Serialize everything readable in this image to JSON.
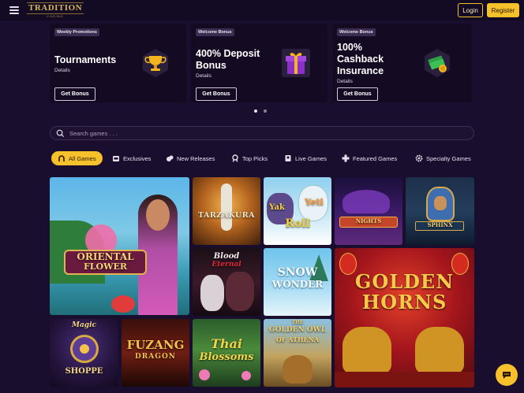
{
  "header": {
    "logo_text": "TRADITION",
    "logo_sub": "CASINO",
    "login_label": "Login",
    "register_label": "Register"
  },
  "promos": [
    {
      "tag": "Weekly Promotions",
      "title": "Tournaments",
      "details": "Details",
      "button": "Get Bonus",
      "icon": "trophy-icon"
    },
    {
      "tag": "Welcome Bonus",
      "title_line1": "400% Deposit",
      "title_line2": "Bonus",
      "details": "Details",
      "button": "Get Bonus",
      "icon": "gift-box-icon"
    },
    {
      "tag": "Welcome Bonus",
      "title_line1": "100%",
      "title_line2": "Cashback",
      "title_line3": "Insurance",
      "details": "Details",
      "button": "Get Bonus",
      "icon": "cash-stack-icon"
    }
  ],
  "carousel": {
    "pages": 2,
    "active": 1
  },
  "search": {
    "placeholder": "Search games . . ."
  },
  "categories": [
    {
      "label": "All Games",
      "icon": "horseshoe-icon",
      "active": true
    },
    {
      "label": "Exclusives",
      "icon": "slot-machine-icon"
    },
    {
      "label": "New Releases",
      "icon": "chips-icon"
    },
    {
      "label": "Top Picks",
      "icon": "medal-icon"
    },
    {
      "label": "Live Games",
      "icon": "dealer-icon"
    },
    {
      "label": "Featured Games",
      "icon": "clover-icon"
    },
    {
      "label": "Specialty Games",
      "icon": "gear-icon"
    }
  ],
  "games": {
    "oriental_flower": [
      "ORIENTAL",
      "FLOWER"
    ],
    "tarzakura": "TARZAKURA",
    "yak_yeti_roll": [
      "Yak",
      "Yeti",
      "Roll"
    ],
    "arabian_nights": "NIGHTS",
    "sphinx": "SPHINX",
    "blood_eternal": [
      "Blood",
      "Eternal"
    ],
    "snow_wonder": [
      "SNOW",
      "WONDER"
    ],
    "golden_horns": [
      "GOLDEN",
      "HORNS"
    ],
    "magic_shoppe": [
      "Magic",
      "SHOPPE"
    ],
    "fuzang_dragon": [
      "FUZANG",
      "DRAGON"
    ],
    "thai_blossoms": [
      "Thai",
      "Blossoms"
    ],
    "golden_owl": [
      "THE",
      "GOLDEN OWL",
      "OF ATHENA"
    ]
  },
  "colors": {
    "accent": "#f7c12b",
    "background": "#1a0e2e",
    "card": "#140b22"
  }
}
